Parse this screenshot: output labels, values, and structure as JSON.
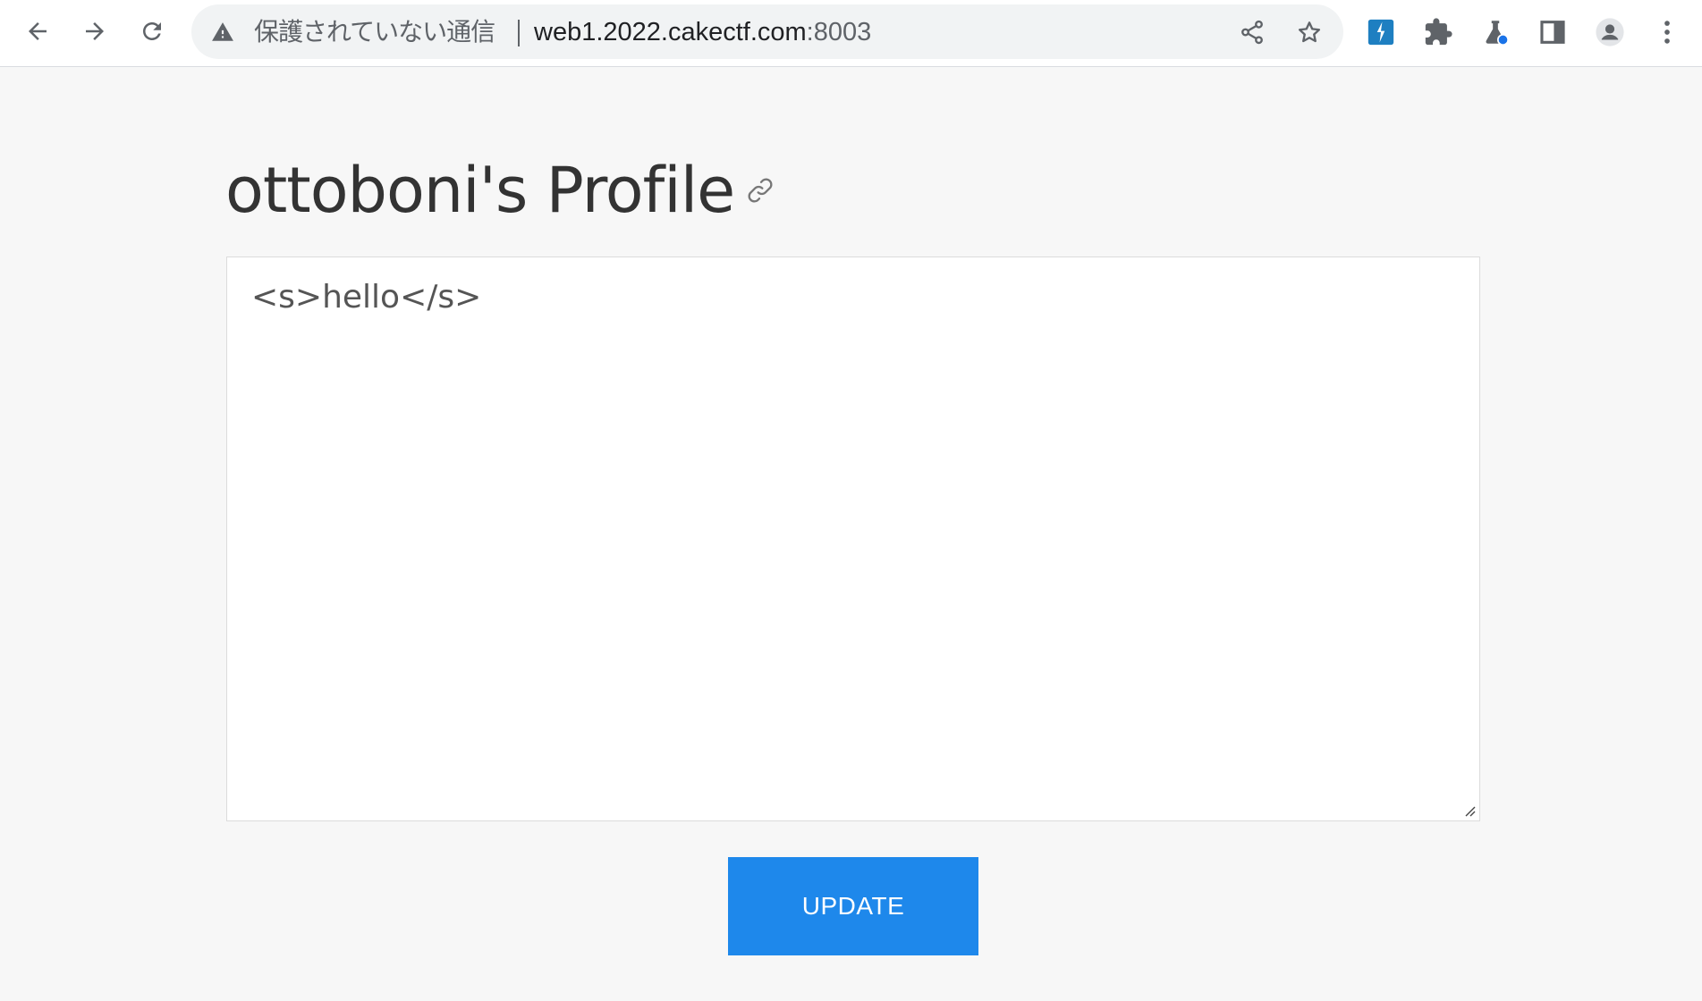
{
  "browser": {
    "security_label": "保護されていない通信",
    "url_host": "web1.2022.cakectf.com",
    "url_port": ":8003",
    "icons": [
      "back-arrow-icon",
      "forward-arrow-icon",
      "reload-icon",
      "warning-icon",
      "share-icon",
      "bookmark-star-icon",
      "extension-icon",
      "puzzle-icon",
      "labs-flask-icon",
      "side-panel-icon",
      "profile-avatar-icon",
      "kebab-menu-icon"
    ]
  },
  "page": {
    "title": "ottoboni's Profile",
    "editor_value": "<s>hello</s>",
    "update_label": "UPDATE"
  },
  "colors": {
    "button": "#1e88eb",
    "page_bg": "#f7f7f7",
    "title_text": "#333333"
  }
}
